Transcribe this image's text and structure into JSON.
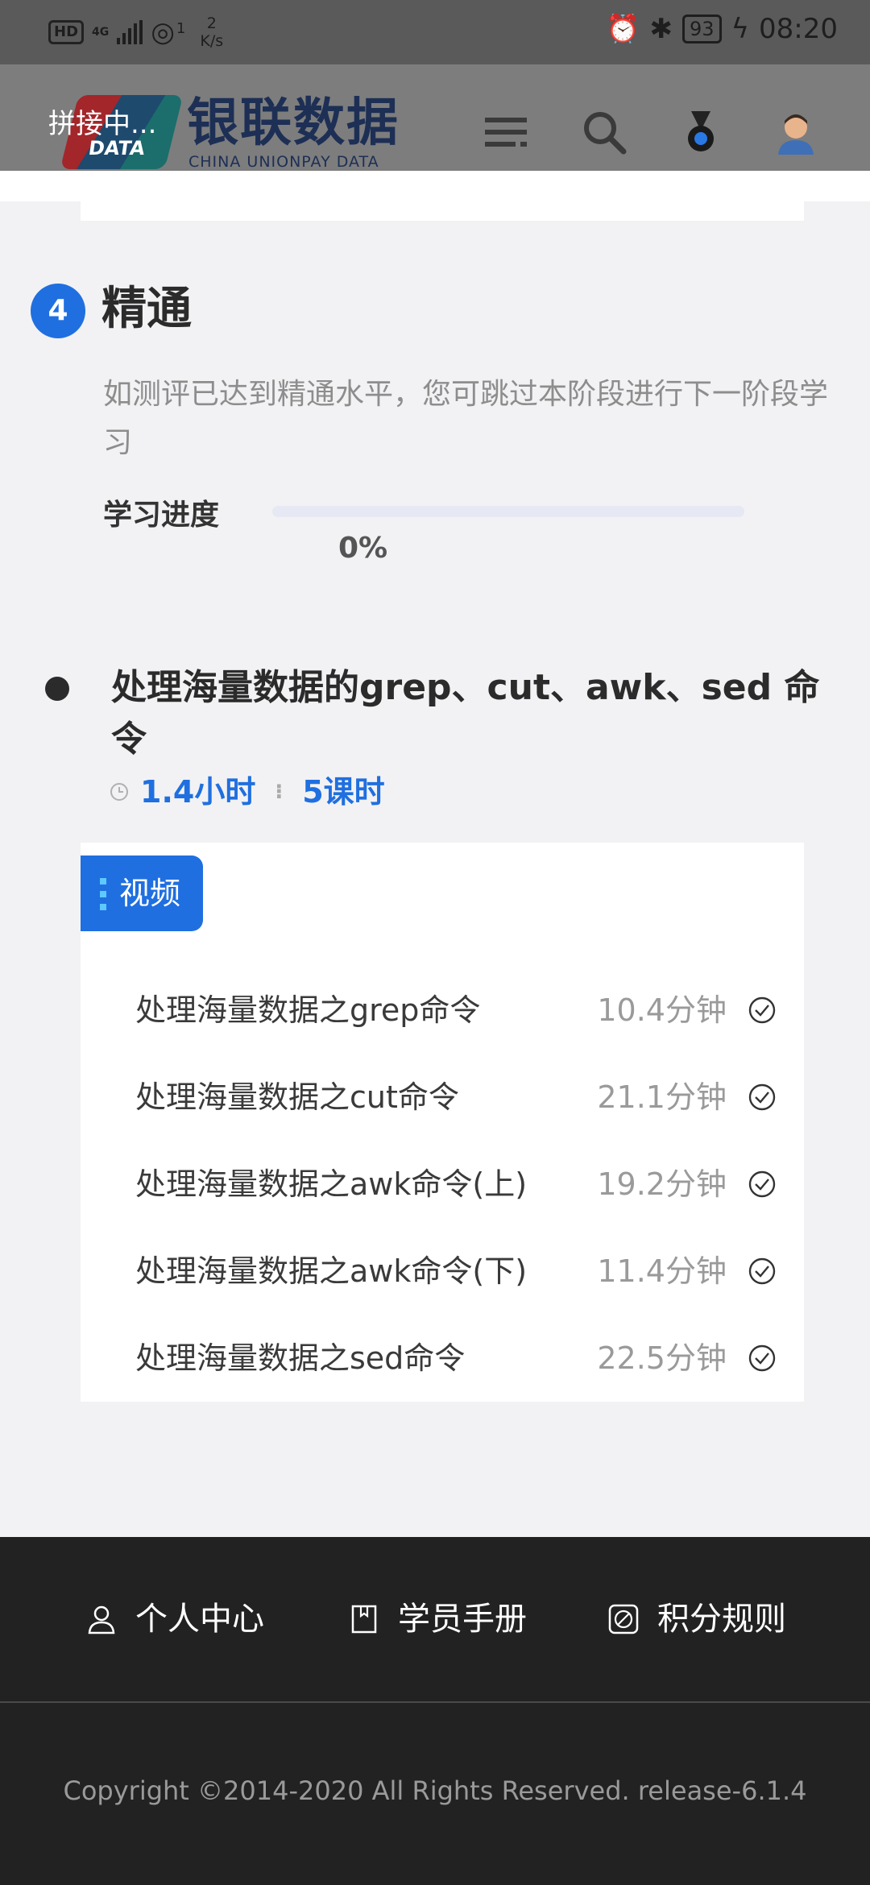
{
  "status_bar": {
    "hd": "HD",
    "network": "4G",
    "wifi_sub": "1",
    "speed_value": "2",
    "speed_unit": "K/s",
    "battery": "93",
    "time": "08:20"
  },
  "header": {
    "splice_label": "拼接中...",
    "logo_text": "DATA",
    "brand_cn": "银联数据",
    "brand_en": "CHINA UNIONPAY DATA",
    "icons": [
      "menu-icon",
      "search-icon",
      "medal-icon",
      "avatar"
    ]
  },
  "stage": {
    "number": "4",
    "title": "精通",
    "description": "如测评已达到精通水平，您可跳过本阶段进行下一阶段学习",
    "progress_label": "学习进度",
    "progress_value": 0,
    "progress_text": "0%"
  },
  "course": {
    "title": "处理海量数据的grep、cut、awk、sed 命令",
    "hours": "1.4小时",
    "lessons_count": "5课时",
    "tag": "视频",
    "lessons": [
      {
        "name": "处理海量数据之grep命令",
        "duration": "10.4分钟"
      },
      {
        "name": "处理海量数据之cut命令",
        "duration": "21.1分钟"
      },
      {
        "name": "处理海量数据之awk命令(上)",
        "duration": "19.2分钟"
      },
      {
        "name": "处理海量数据之awk命令(下)",
        "duration": "11.4分钟"
      },
      {
        "name": "处理海量数据之sed命令",
        "duration": "22.5分钟"
      }
    ]
  },
  "footer": {
    "links": [
      {
        "label": "个人中心",
        "icon": "user-icon"
      },
      {
        "label": "学员手册",
        "icon": "book-icon"
      },
      {
        "label": "积分规则",
        "icon": "rules-icon"
      }
    ],
    "copyright": "Copyright ©2014-2020 All Rights Reserved. release-6.1.4"
  },
  "colors": {
    "accent": "#1f6fe0",
    "footer_bg": "#222222",
    "page_bg": "#f2f2f4"
  }
}
